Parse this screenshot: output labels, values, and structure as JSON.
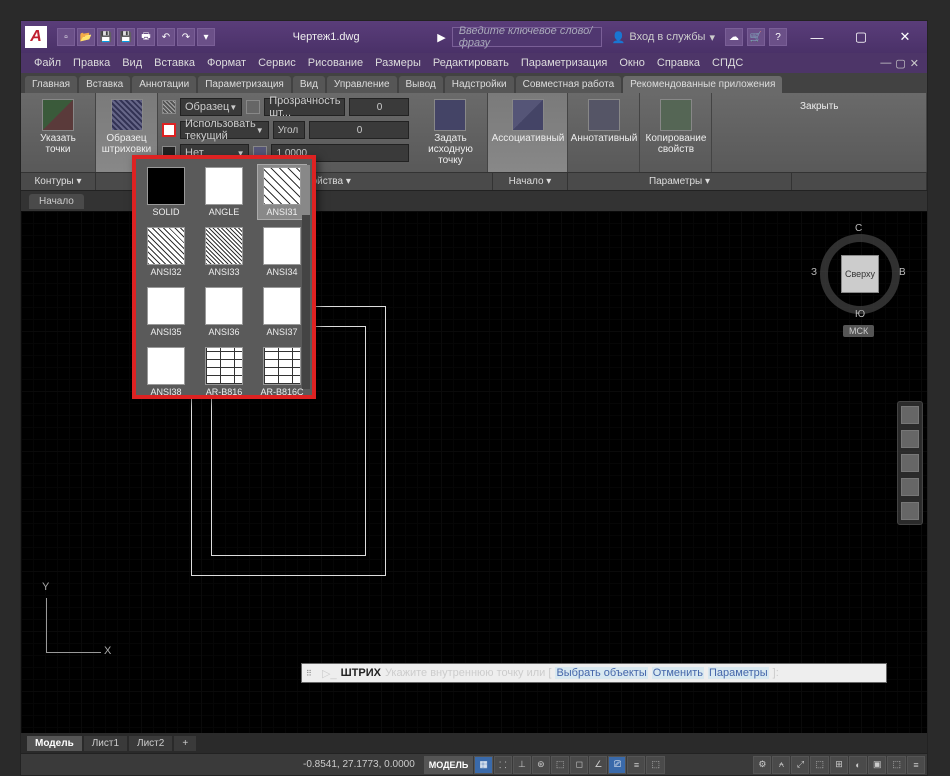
{
  "title": "Чертеж1.dwg",
  "search_placeholder": "Введите ключевое слово/фразу",
  "login": "Вход в службы",
  "menu": [
    "Файл",
    "Правка",
    "Вид",
    "Вставка",
    "Формат",
    "Сервис",
    "Рисование",
    "Размеры",
    "Редактировать",
    "Параметризация",
    "Окно",
    "Справка",
    "СПДС"
  ],
  "tabs": [
    "Главная",
    "Вставка",
    "Аннотации",
    "Параметризация",
    "Вид",
    "Управление",
    "Вывод",
    "Надстройки",
    "Совместная работа",
    "Рекомендованные приложения"
  ],
  "ribbon": {
    "pick": "Указать точки",
    "pattern": "Образец штриховки",
    "props": {
      "type_label": "Образец",
      "color_label": "Использовать текущий",
      "none_label": "Нет",
      "trans_label": "Прозрачность шт...",
      "angle_label": "Угол",
      "trans_val": "0",
      "angle_val": "0",
      "scale_val": "1.0000"
    },
    "origin": "Задать исходную точку",
    "assoc": "Ассоциативный",
    "annot": "Аннотативный",
    "copy": "Копирование свойств",
    "close": "Закрыть"
  },
  "ribbonfoot": {
    "c": "Контуры ▾",
    "p": "Свойства ▾",
    "o": "Начало ▾",
    "opt": "Параметры ▾"
  },
  "doctab": "Начало",
  "patterns": [
    "SOLID",
    "ANGLE",
    "ANSI31",
    "ANSI32",
    "ANSI33",
    "ANSI34",
    "ANSI35",
    "ANSI36",
    "ANSI37",
    "ANSI38",
    "AR-B816",
    "AR-B816C"
  ],
  "pattern_classes": [
    "solid",
    "angle",
    "a31",
    "a32",
    "a33",
    "a34",
    "a35",
    "a36",
    "a37",
    "a38",
    "brick",
    "brick"
  ],
  "selected_pattern": 2,
  "viewcube": {
    "face": "Сверху",
    "n": "С",
    "s": "Ю",
    "e": "В",
    "w": "З",
    "badge": "МСК"
  },
  "cmd": {
    "kw": "ШТРИХ",
    "prompt": "Укажите внутреннюю точку или [",
    "o1": "Выбрать объекты",
    "o2": "Отменить",
    "o3": "Параметры",
    "tail": "]:"
  },
  "layout_tabs": [
    "Модель",
    "Лист1",
    "Лист2",
    "+"
  ],
  "status": {
    "coords": "-0.8541, 27.1773, 0.0000",
    "model": "МОДЕЛЬ"
  }
}
